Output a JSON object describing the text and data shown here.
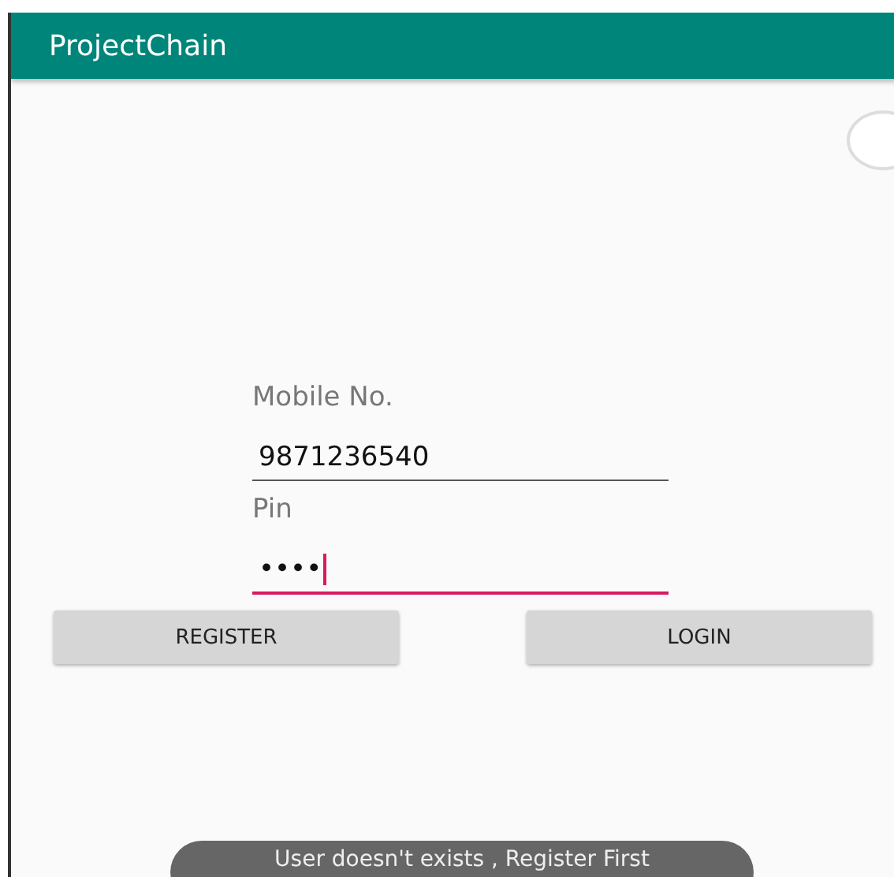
{
  "app_bar": {
    "title": "ProjectChain"
  },
  "fields": [
    {
      "label": "Mobile No.",
      "value": "9871236540",
      "focused": false
    },
    {
      "label": "Pin",
      "value": "••••",
      "focused": true
    }
  ],
  "buttons": [
    "REGISTER",
    "LOGIN"
  ],
  "toast": {
    "message": "User doesn't exists , Register First"
  }
}
